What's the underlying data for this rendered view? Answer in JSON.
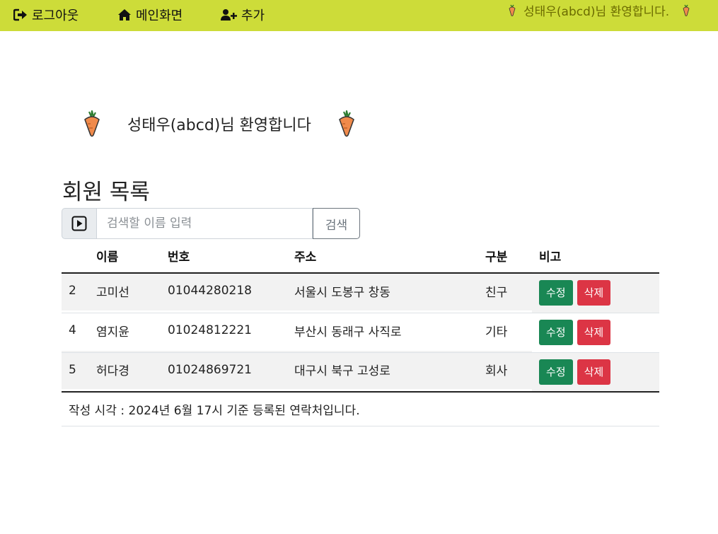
{
  "nav": {
    "logout_label": "로그아웃",
    "home_label": "메인화면",
    "add_label": "추가",
    "welcome_text": "성태우(abcd)님 환영합니다."
  },
  "welcome": {
    "message": "성태우(abcd)님 환영합니다"
  },
  "page_title": "회원 목록",
  "search": {
    "placeholder": "검색할 이름 입력",
    "button_label": "검색"
  },
  "table": {
    "headers": [
      "",
      "이름",
      "번호",
      "주소",
      "구분",
      "비고"
    ],
    "rows": [
      {
        "id": "2",
        "name": "고미선",
        "phone": "01044280218",
        "address": "서울시 도봉구 창동",
        "type": "친구"
      },
      {
        "id": "4",
        "name": "염지윤",
        "phone": "01024812221",
        "address": "부산시 동래구 사직로",
        "type": "기타"
      },
      {
        "id": "5",
        "name": "허다경",
        "phone": "01024869721",
        "address": "대구시 북구 고성로",
        "type": "회사"
      }
    ],
    "edit_label": "수정",
    "delete_label": "삭제"
  },
  "footnote": "작성 시각 : 2024년 6월 17시 기준 등록된 연락처입니다.",
  "colors": {
    "navbar": "#cddc39",
    "edit_button": "#198754",
    "delete_button": "#dc3545",
    "carrot": "#f08a4b"
  },
  "icons": {
    "logout": "sign-out-icon",
    "home": "home-icon",
    "add": "user-plus-icon",
    "search_addon": "play-square-icon",
    "decor": "carrot-icon"
  }
}
